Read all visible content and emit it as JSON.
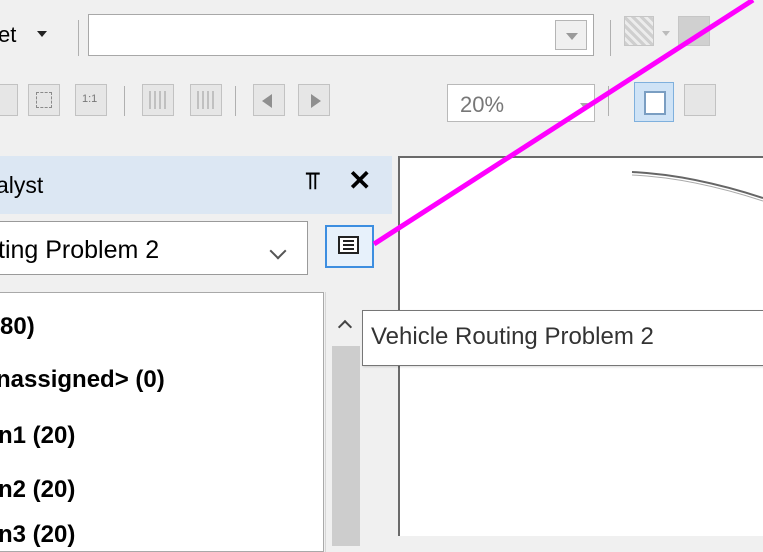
{
  "toolbar": {
    "layer_label": "et",
    "target_value": "",
    "zoom_percent": "20%",
    "zoom_100_label": "1:1"
  },
  "pane": {
    "title": "alyst",
    "pin_glyph": "⫪",
    "close_glyph": "✕",
    "analysis_selected": "ting Problem 2",
    "tree_items": [
      "(80)",
      "nassigned> (0)",
      "n1 (20)",
      "n2 (20)",
      "n3 (20)"
    ]
  },
  "tooltip": {
    "text": "Vehicle Routing Problem 2"
  },
  "colors": {
    "callout": "#ff00ff",
    "accent_border": "#3d8ee0",
    "pane_header": "#dce7f3"
  },
  "icons": {
    "properties": "properties-icon",
    "pin": "pin-icon",
    "close": "close-icon"
  }
}
